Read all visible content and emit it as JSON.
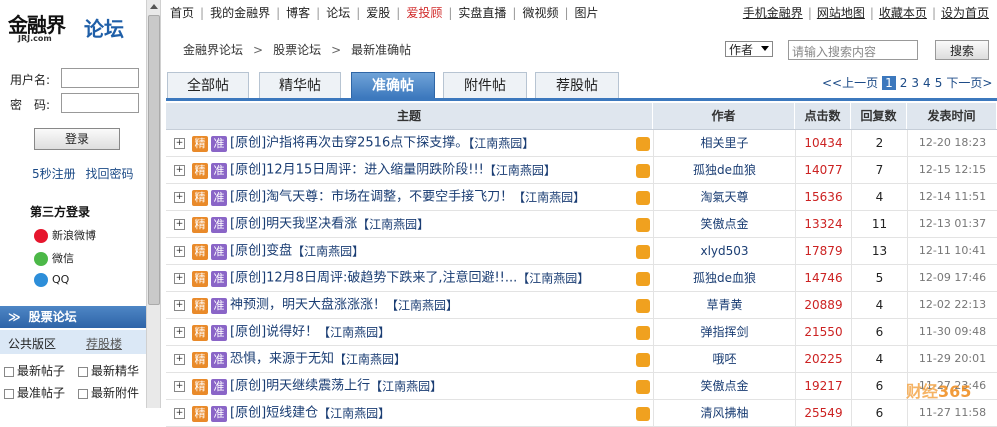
{
  "sidebar": {
    "logo_main": "金融界",
    "logo_forum": "论坛",
    "logo_sub": "JRJ.com",
    "username_label": "用户名:",
    "password_label": "密　码:",
    "login_button": "登录",
    "register_link": "5秒注册",
    "recover_link": "找回密码",
    "third_party_title": "第三方登录",
    "third_party": [
      {
        "label": "新浪微博",
        "icon": "weibo-icon",
        "color": "#e6162d"
      },
      {
        "label": "微信",
        "icon": "wechat-icon",
        "color": "#4cb848"
      },
      {
        "label": "QQ",
        "icon": "qq-icon",
        "color": "#2d8ed9"
      }
    ],
    "board_title": "股票论坛",
    "board_public": "公共版区",
    "board_public_right": "荐股楼",
    "board_links": [
      "最新帖子",
      "最新精华",
      "最准帖子",
      "最新附件"
    ]
  },
  "topnav": {
    "left": [
      "首页",
      "我的金融界",
      "博客",
      "论坛",
      "爱股",
      "爱投顾",
      "实盘直播",
      "微视频",
      "图片"
    ],
    "highlight_index": 5,
    "right": [
      "手机金融界",
      "网站地图",
      "收藏本页",
      "设为首页"
    ]
  },
  "breadcrumb": [
    "金融界论坛",
    "股票论坛",
    "最新准确帖"
  ],
  "search": {
    "field_select": "作者",
    "placeholder": "请输入搜索内容",
    "button": "搜索"
  },
  "tabs": [
    {
      "label": "全部帖",
      "active": false
    },
    {
      "label": "精华帖",
      "active": false
    },
    {
      "label": "准确帖",
      "active": true
    },
    {
      "label": "附件帖",
      "active": false
    },
    {
      "label": "荐股帖",
      "active": false
    }
  ],
  "pager": {
    "prev": "<<上一页",
    "pages": [
      "1",
      "2",
      "3",
      "4",
      "5"
    ],
    "current": "1",
    "next": "下一页>"
  },
  "table": {
    "headers": [
      "主题",
      "作者",
      "点击数",
      "回复数",
      "发表时间"
    ],
    "rows": [
      {
        "badges": [
          "精",
          "准"
        ],
        "title": "[原创]沪指将再次击穿2516点下探支撑。",
        "tag": "【江南燕园】",
        "thumb": true,
        "author": "相关里子",
        "clicks": "10434",
        "replies": "2",
        "time": "12-20 18:23"
      },
      {
        "badges": [
          "精",
          "准"
        ],
        "title": "[原创]12月15日周评：进入缩量阴跌阶段!!!",
        "tag": "【江南燕园】",
        "thumb": true,
        "author": "孤独de血狼",
        "clicks": "14077",
        "replies": "7",
        "time": "12-15 12:15"
      },
      {
        "badges": [
          "精",
          "准"
        ],
        "title": "[原创]淘气天尊：市场在调整，不要空手接飞刀！",
        "tag": "【江南燕园】",
        "thumb": true,
        "author": "淘氣天尊",
        "clicks": "15636",
        "replies": "4",
        "time": "12-14 11:51"
      },
      {
        "badges": [
          "精",
          "准"
        ],
        "title": "[原创]明天我坚决看涨",
        "tag": "【江南燕园】",
        "thumb": true,
        "author": "笑傲点金",
        "clicks": "13324",
        "replies": "11",
        "time": "12-13 01:37"
      },
      {
        "badges": [
          "精",
          "准"
        ],
        "title": "[原创]变盘",
        "tag": "【江南燕园】",
        "thumb": true,
        "author": "xlyd503",
        "clicks": "17879",
        "replies": "13",
        "time": "12-11 10:41"
      },
      {
        "badges": [
          "精",
          "准"
        ],
        "title": "[原创]12月8日周评:破趋势下跌来了,注意回避!!...",
        "tag": "【江南燕园】",
        "thumb": true,
        "author": "孤独de血狼",
        "clicks": "14746",
        "replies": "5",
        "time": "12-09 17:46"
      },
      {
        "badges": [
          "精",
          "准"
        ],
        "title": "神预测，明天大盘涨涨涨！",
        "tag": "【江南燕园】",
        "thumb": true,
        "author": "草青黄",
        "clicks": "20889",
        "replies": "4",
        "time": "12-02 22:13"
      },
      {
        "badges": [
          "精",
          "准"
        ],
        "title": "[原创]说得好！",
        "tag": "【江南燕园】",
        "thumb": true,
        "author": "弹指挥剑",
        "clicks": "21550",
        "replies": "6",
        "time": "11-30 09:48"
      },
      {
        "badges": [
          "精",
          "准"
        ],
        "title": "恐惧，来源于无知",
        "tag": "【江南燕园】",
        "thumb": true,
        "author": "哦呸",
        "clicks": "20225",
        "replies": "4",
        "time": "11-29 20:01"
      },
      {
        "badges": [
          "精",
          "准"
        ],
        "title": "[原创]明天继续震荡上行",
        "tag": "【江南燕园】",
        "thumb": true,
        "author": "笑傲点金",
        "clicks": "19217",
        "replies": "6",
        "time": "11-27 23:46"
      },
      {
        "badges": [
          "精",
          "准"
        ],
        "title": "[原创]短线建仓",
        "tag": "【江南燕园】",
        "thumb": true,
        "author": "清风拂柚",
        "clicks": "25549",
        "replies": "6",
        "time": "11-27 11:58"
      }
    ]
  },
  "watermark": {
    "text": "财经",
    "num": "365"
  },
  "colors": {
    "accent": "#3c78bd",
    "clicks": "#cc2222",
    "badge_jing": "#e98a2a",
    "badge_zhun": "#8a65c7"
  }
}
